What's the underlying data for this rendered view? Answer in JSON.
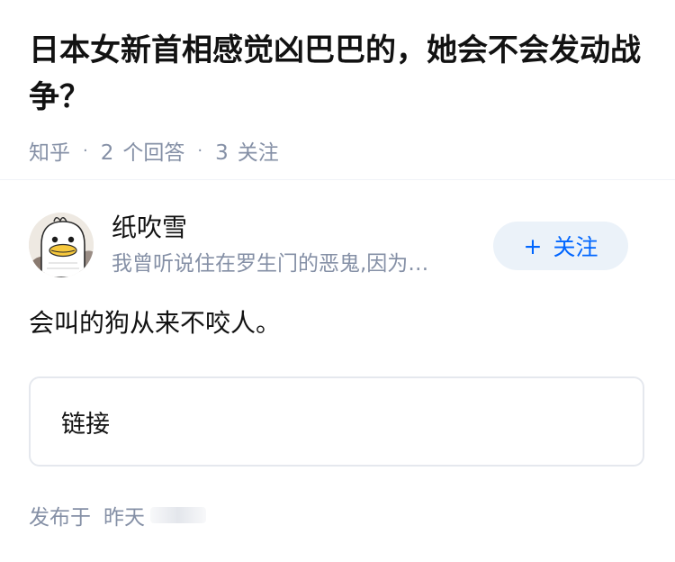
{
  "question": {
    "title": "日本女新首相感觉凶巴巴的，她会不会发动战争？",
    "source": "知乎",
    "answer_count": "2",
    "answer_label": "个回答",
    "follower_count": "3",
    "follower_label": "关注"
  },
  "answer": {
    "author": {
      "name": "纸吹雪",
      "bio": "我曾听说住在罗生门的恶鬼,因为…",
      "avatar_icon": "cartoon-duck-avatar"
    },
    "follow_button": {
      "icon": "plus-icon",
      "label": "关注",
      "color": "#0066ff",
      "background": "#ebf2f9"
    },
    "content": "会叫的狗从来不咬人。",
    "link_card": {
      "label": "链接"
    },
    "publish": {
      "label": "发布于",
      "time": "昨天"
    }
  }
}
